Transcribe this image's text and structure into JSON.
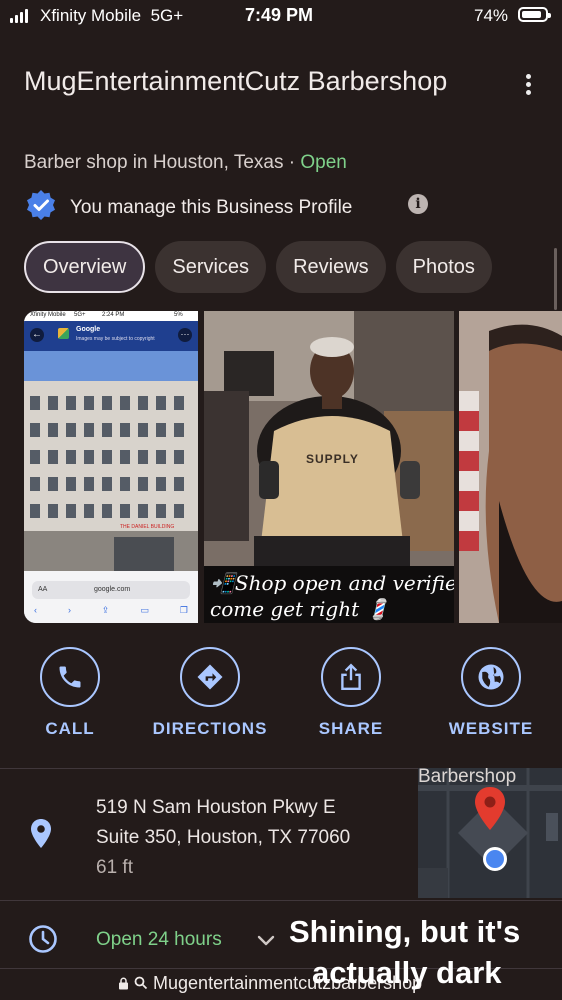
{
  "status": {
    "carrier": "Xfinity Mobile",
    "network": "5G+",
    "time": "7:49 PM",
    "battery": "74%",
    "battery_level": 0.74
  },
  "business": {
    "name": "MugEntertainmentCutz Barbershop",
    "category": "Barber shop in Houston, Texas",
    "separator": " · ",
    "open_status": "Open",
    "manage_text": "You manage this Business Profile"
  },
  "tabs": [
    {
      "label": "Overview",
      "active": true
    },
    {
      "label": "Services"
    },
    {
      "label": "Reviews"
    },
    {
      "label": "Photos"
    }
  ],
  "photos": {
    "p1": {
      "status_carrier": "Xfinity Mobile",
      "status_network": "5G+",
      "status_time": "2:24 PM",
      "status_batt": "5%",
      "app": "Google",
      "notice": "Images may be subject to copyright",
      "sign": "THE DANIEL BUILDING",
      "aa": "AA",
      "url": "google.com"
    },
    "p2": {
      "shirt_text": "SUPPLY",
      "caption_line1": "📲Shop open and verified",
      "caption_line2": "come get right 💈"
    }
  },
  "actions": [
    {
      "label": "CALL",
      "icon": "phone-icon"
    },
    {
      "label": "DIRECTIONS",
      "icon": "directions-icon"
    },
    {
      "label": "SHARE",
      "icon": "share-icon"
    },
    {
      "label": "WEBSITE",
      "icon": "globe-icon"
    }
  ],
  "address": {
    "line1": "519 N Sam Houston Pkwy E",
    "line2": "Suite 350, Houston, TX 77060",
    "distance": "61 ft"
  },
  "map": {
    "label": "Barbershop"
  },
  "hours": {
    "text": "Open 24 hours"
  },
  "overlay": {
    "line1": "Shining, but it's",
    "line2": "actually dark"
  },
  "browser": {
    "url": "Mugentertainmentcutzbarbershop"
  },
  "colors": {
    "background": "#231b1a",
    "accent": "#aac7ff",
    "open": "#7fd18a",
    "pin": "#e33b2e"
  }
}
